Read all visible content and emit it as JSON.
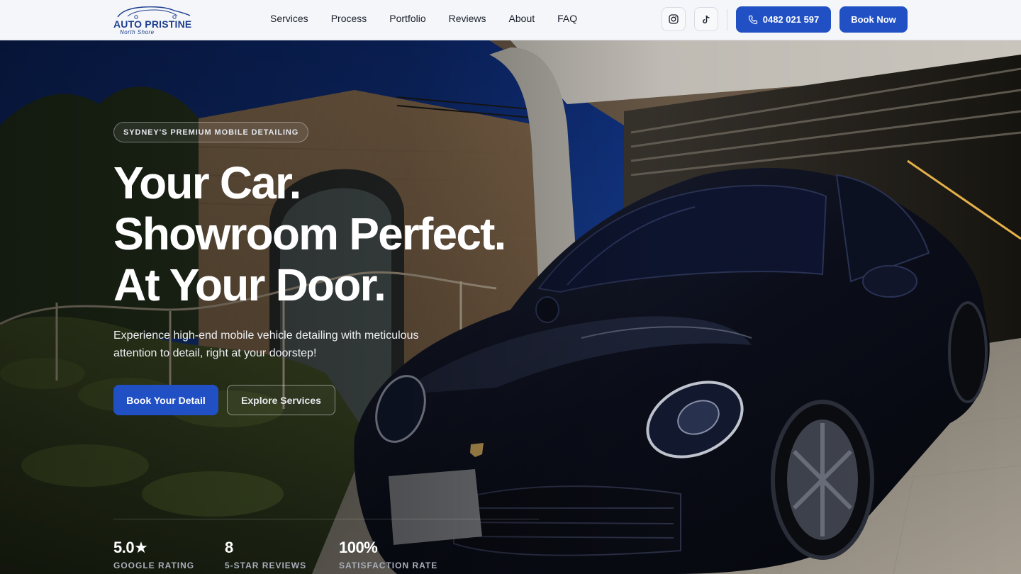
{
  "brand": {
    "name": "AUTO PRISTINE",
    "tagline": "North Shore"
  },
  "nav": {
    "items": [
      {
        "label": "Services"
      },
      {
        "label": "Process"
      },
      {
        "label": "Portfolio"
      },
      {
        "label": "Reviews"
      },
      {
        "label": "About"
      },
      {
        "label": "FAQ"
      }
    ],
    "phone": "0482 021 597",
    "book": "Book Now"
  },
  "hero": {
    "badge": "SYDNEY'S PREMIUM MOBILE DETAILING",
    "headline": [
      "Your Car.",
      "Showroom Perfect.",
      "At Your Door."
    ],
    "subtitle": "Experience high-end mobile vehicle detailing with meticulous attention to detail, right at your doorstep!",
    "cta_primary": "Book Your Detail",
    "cta_secondary": "Explore Services"
  },
  "stats": [
    {
      "value": "5.0★",
      "label": "GOOGLE RATING"
    },
    {
      "value": "8",
      "label": "5-STAR REVIEWS"
    },
    {
      "value": "100%",
      "label": "SATISFACTION RATE"
    }
  ],
  "colors": {
    "accent": "#2150c4",
    "brand_text": "#1d3f8f",
    "nav_bg": "#f4f6f9"
  },
  "icons": {
    "instagram": "instagram-icon",
    "tiktok": "tiktok-icon",
    "phone": "phone-icon"
  }
}
